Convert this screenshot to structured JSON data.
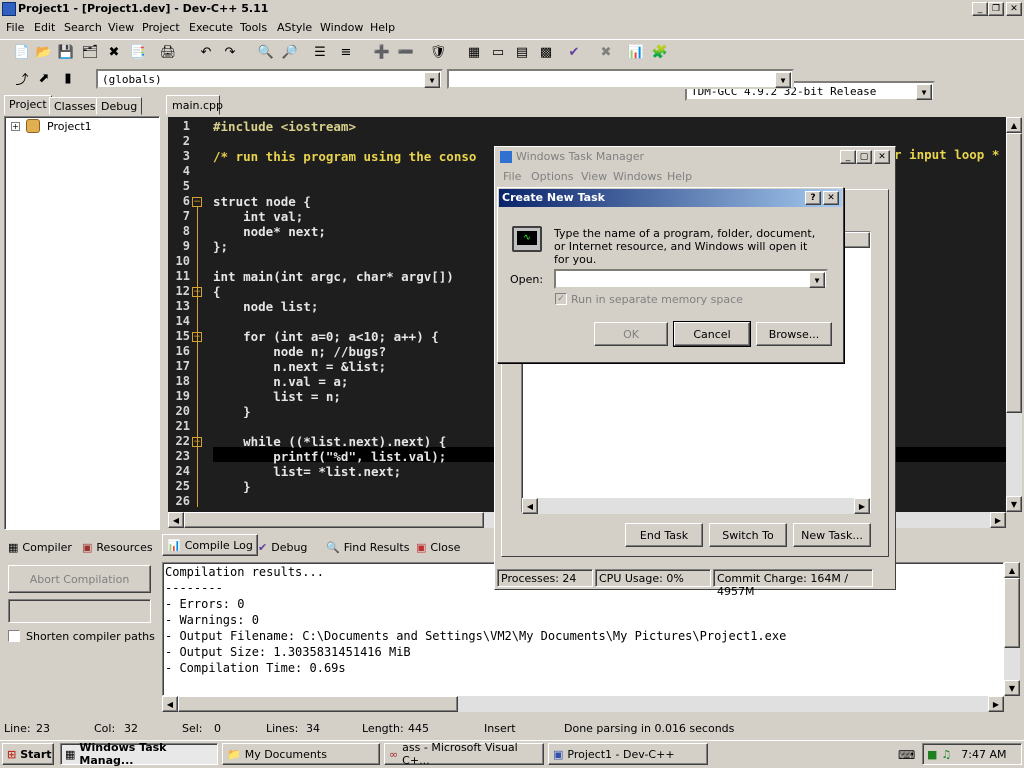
{
  "app": {
    "title": "Project1 - [Project1.dev] - Dev-C++ 5.11",
    "menu": [
      "File",
      "Edit",
      "Search",
      "View",
      "Project",
      "Execute",
      "Tools",
      "AStyle",
      "Window",
      "Help"
    ],
    "compiler_select": "TDM-GCC 4.9.2 32-bit Release",
    "scope_select": "(globals)",
    "scope_select2": ""
  },
  "left_panel": {
    "tabs": [
      "Project",
      "Classes",
      "Debug"
    ],
    "tree_root": "Project1"
  },
  "editor": {
    "tab": "main.cpp",
    "lines": [
      "#include <iostream>",
      "",
      "/* run this program using the conso",
      "",
      "",
      "struct node {",
      "    int val;",
      "    node* next;",
      "};",
      "",
      "int main(int argc, char* argv[])",
      "{",
      "    node list;",
      "",
      "    for (int a=0; a<10; a++) {",
      "        node n; //bugs?",
      "        n.next = &list;",
      "        n.val = a;",
      "        list = n;",
      "    }",
      "",
      "    while ((*list.next).next) {",
      "        printf(\"%d\", list.val);",
      "        list= *list.next;",
      "    }",
      ""
    ],
    "line3_tail": "r input loop *"
  },
  "bottom_tabs": [
    "Compiler",
    "Resources",
    "Compile Log",
    "Debug",
    "Find Results",
    "Close"
  ],
  "bottom_left": {
    "abort_label": "Abort Compilation",
    "shorten_label": "Shorten compiler paths"
  },
  "log_lines": [
    "Compilation results...",
    "--------",
    "- Errors: 0",
    "- Warnings: 0",
    "- Output Filename: C:\\Documents and Settings\\VM2\\My Documents\\My Pictures\\Project1.exe",
    "- Output Size: 1.3035831451416 MiB",
    "- Compilation Time: 0.69s"
  ],
  "status": {
    "line_label": "Line:",
    "line": "23",
    "col_label": "Col:",
    "col": "32",
    "sel_label": "Sel:",
    "sel": "0",
    "lines_label": "Lines:",
    "lines": "34",
    "length_label": "Length:",
    "length": "445",
    "mode": "Insert",
    "message": "Done parsing in 0.016 seconds"
  },
  "taskmgr": {
    "title": "Windows Task Manager",
    "menu": [
      "File",
      "Options",
      "View",
      "Windows",
      "Help"
    ],
    "buttons": [
      "End Task",
      "Switch To",
      "New Task..."
    ],
    "processes": "Processes: 24",
    "cpu": "CPU Usage: 0%",
    "commit": "Commit Charge: 164M / 4957M"
  },
  "dialog": {
    "title": "Create New Task",
    "description": "Type the name of a program, folder, document, or Internet resource, and Windows will open it for you.",
    "open_label": "Open:",
    "open_value": "",
    "checkbox_label": "Run in separate memory space",
    "ok": "OK",
    "cancel": "Cancel",
    "browse": "Browse..."
  },
  "taskbar": {
    "start": "Start",
    "tasks": [
      "Windows Task Manag...",
      "My Documents",
      "ass - Microsoft Visual C+...",
      "Project1 - Dev-C++"
    ],
    "clock": "7:47 AM"
  }
}
